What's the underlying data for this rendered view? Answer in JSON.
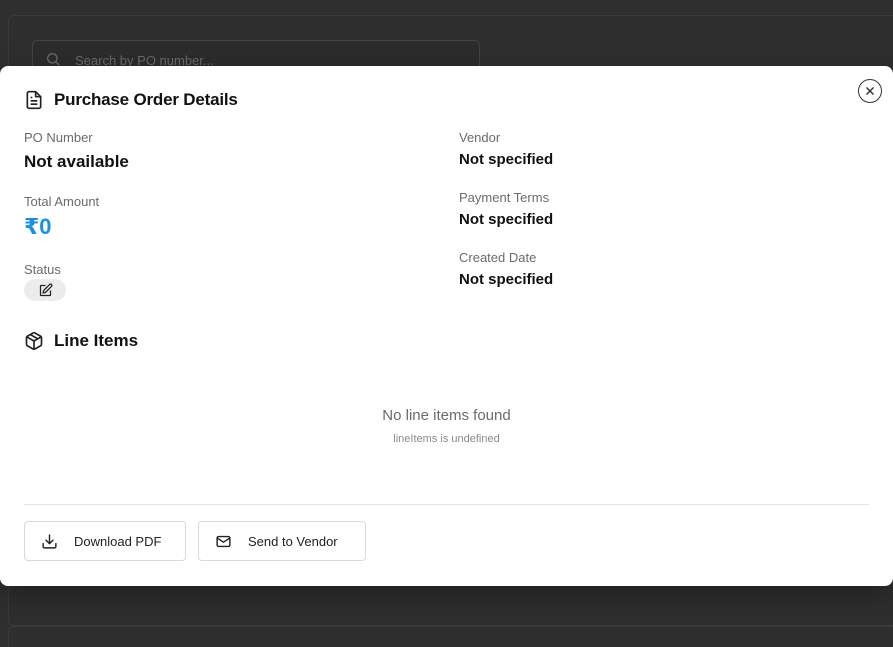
{
  "background": {
    "search_placeholder": "Search by PO number..."
  },
  "modal": {
    "title": "Purchase Order Details",
    "close_icon": "close-icon",
    "fields": {
      "po_number_label": "PO Number",
      "po_number_value": "Not available",
      "total_amount_label": "Total Amount",
      "total_amount_value": "₹0",
      "status_label": "Status",
      "vendor_label": "Vendor",
      "vendor_value": "Not specified",
      "payment_terms_label": "Payment Terms",
      "payment_terms_value": "Not specified",
      "created_date_label": "Created Date",
      "created_date_value": "Not specified"
    },
    "line_items": {
      "title": "Line Items",
      "empty_title": "No line items found",
      "empty_subtitle": "lineItems is undefined"
    },
    "actions": {
      "download_label": "Download PDF",
      "send_label": "Send to Vendor"
    }
  },
  "colors": {
    "accent": "#1a90e0",
    "overlay": "#2f2f2f"
  }
}
